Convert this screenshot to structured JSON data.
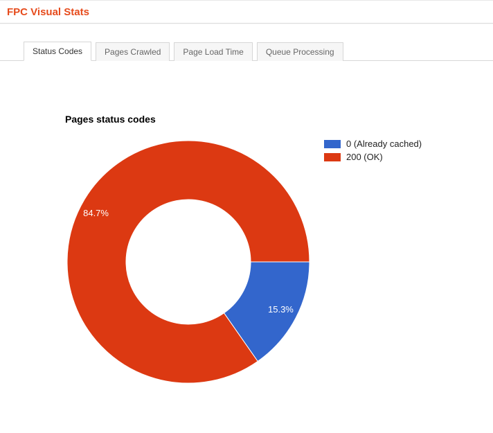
{
  "header": {
    "title": "FPC Visual Stats"
  },
  "tabs": [
    {
      "label": "Status Codes",
      "active": true
    },
    {
      "label": "Pages Crawled",
      "active": false
    },
    {
      "label": "Page Load Time",
      "active": false
    },
    {
      "label": "Queue Processing",
      "active": false
    }
  ],
  "chart": {
    "title": "Pages status codes"
  },
  "legend": {
    "items": [
      {
        "swatch_color": "#3366cc",
        "label": "0 (Already cached)"
      },
      {
        "swatch_color": "#dc3912",
        "label": "200 (OK)"
      }
    ]
  },
  "chart_data": {
    "type": "pie",
    "title": "Pages status codes",
    "series": [
      {
        "name": "0 (Already cached)",
        "value": 15.3,
        "color": "#3366cc",
        "label": "15.3%"
      },
      {
        "name": "200 (OK)",
        "value": 84.7,
        "color": "#dc3912",
        "label": "84.7%"
      }
    ],
    "inner_radius_pct": 50,
    "total": 100
  }
}
